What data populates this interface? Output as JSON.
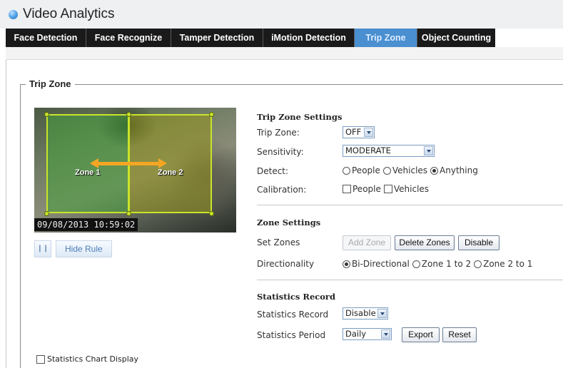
{
  "app": {
    "title": "Video Analytics",
    "logo_icon": "blue-sphere-icon"
  },
  "tabs": [
    {
      "label": "Face Detection",
      "active": false
    },
    {
      "label": "Face Recognize",
      "active": false
    },
    {
      "label": "Tamper Detection",
      "active": false
    },
    {
      "label": "iMotion Detection",
      "active": false
    },
    {
      "label": "Trip Zone",
      "active": true
    },
    {
      "label": "Object Counting",
      "active": false
    }
  ],
  "panel": {
    "legend": "Trip Zone"
  },
  "video": {
    "zone1_label": "Zone 1",
    "zone2_label": "Zone 2",
    "timestamp": "09/08/2013  10:59:02",
    "pause_icon": "pause-icon",
    "hide_rule_label": "Hide Rule"
  },
  "stats_chart_display": {
    "label": "Statistics Chart Display",
    "checked": false
  },
  "trip_zone_settings": {
    "title": "Trip Zone Settings",
    "trip_zone": {
      "label": "Trip Zone:",
      "value": "OFF"
    },
    "sensitivity": {
      "label": "Sensitivity:",
      "value": "MODERATE"
    },
    "detect": {
      "label": "Detect:",
      "options": [
        "People",
        "Vehicles",
        "Anything"
      ],
      "selected": "Anything"
    },
    "calibration": {
      "label": "Calibration:",
      "options": [
        "People",
        "Vehicles"
      ]
    }
  },
  "zone_settings": {
    "title": "Zone Settings",
    "set_zones": {
      "label": "Set Zones",
      "add_zone": "Add Zone",
      "delete_zones": "Delete Zones",
      "disable": "Disable"
    },
    "directionality": {
      "label": "Directionality",
      "options": [
        "Bi-Directional",
        "Zone 1 to 2",
        "Zone 2 to 1"
      ],
      "selected": "Bi-Directional"
    }
  },
  "statistics_record": {
    "title": "Statistics Record",
    "record": {
      "label": "Statistics Record",
      "value": "Disable"
    },
    "period": {
      "label": "Statistics Period",
      "value": "Daily"
    },
    "export": "Export",
    "reset": "Reset"
  }
}
